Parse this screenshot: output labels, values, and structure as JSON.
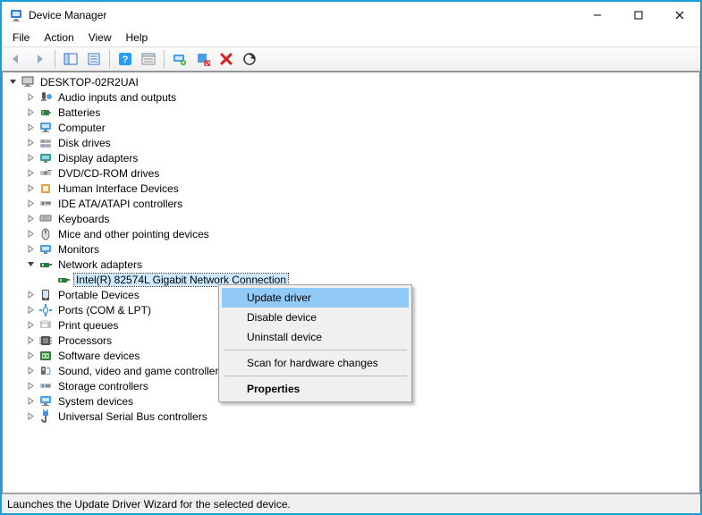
{
  "window": {
    "title": "Device Manager"
  },
  "menu": {
    "file": "File",
    "action": "Action",
    "view": "View",
    "help": "Help"
  },
  "toolbar": {
    "back": "Back",
    "forward": "Forward",
    "show_hide_tree": "Show/Hide Console Tree",
    "properties": "Properties",
    "help": "Help",
    "show_hidden": "Show hidden devices",
    "update_driver": "Update device driver",
    "uninstall": "Uninstall device",
    "disable": "Disable device",
    "scan": "Scan for hardware changes"
  },
  "tree": {
    "root": "DESKTOP-02R2UAI",
    "categories": [
      "Audio inputs and outputs",
      "Batteries",
      "Computer",
      "Disk drives",
      "Display adapters",
      "DVD/CD-ROM drives",
      "Human Interface Devices",
      "IDE ATA/ATAPI controllers",
      "Keyboards",
      "Mice and other pointing devices",
      "Monitors",
      "Network adapters",
      "Portable Devices",
      "Ports (COM & LPT)",
      "Print queues",
      "Processors",
      "Software devices",
      "Sound, video and game controllers",
      "Storage controllers",
      "System devices",
      "Universal Serial Bus controllers"
    ],
    "network_device": "Intel(R) 82574L Gigabit Network Connection"
  },
  "context_menu": {
    "update": "Update driver",
    "disable": "Disable device",
    "uninstall": "Uninstall device",
    "scan": "Scan for hardware changes",
    "properties": "Properties"
  },
  "status": "Launches the Update Driver Wizard for the selected device."
}
